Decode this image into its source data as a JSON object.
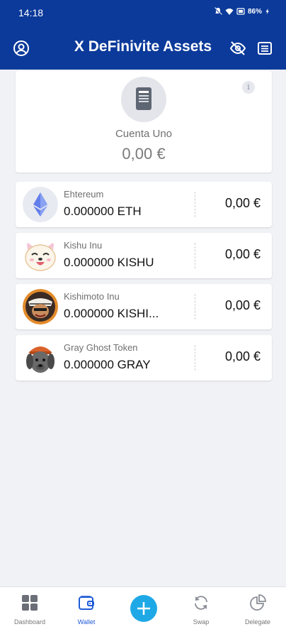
{
  "status_bar": {
    "time": "14:18",
    "battery": "86%"
  },
  "app_bar": {
    "title": "X DeFinivite Assets"
  },
  "account": {
    "name": "Cuenta Uno",
    "value": "0,00 €",
    "info_glyph": "i"
  },
  "tokens": [
    {
      "name": "Ehtereum",
      "balance": "0.000000 ETH",
      "value": "0,00 €",
      "icon": "ethereum-logo"
    },
    {
      "name": "Kishu Inu",
      "balance": "0.000000 KISHU",
      "value": "0,00 €",
      "icon": "kishu-dog-logo"
    },
    {
      "name": "Kishimoto Inu",
      "balance": "0.000000 KISHI...",
      "value": "0,00 €",
      "icon": "kishimoto-samurai-logo"
    },
    {
      "name": "Gray Ghost Token",
      "balance": "0.000000 GRAY",
      "value": "0,00 €",
      "icon": "gray-ghost-dog-logo"
    }
  ],
  "nav": {
    "dashboard": "Dashboard",
    "wallet": "Wallet",
    "swap": "Swap",
    "delegate": "Delegate"
  },
  "colors": {
    "primary": "#0b3a9a",
    "fab": "#1ea9e6",
    "active": "#1f5bd6"
  }
}
